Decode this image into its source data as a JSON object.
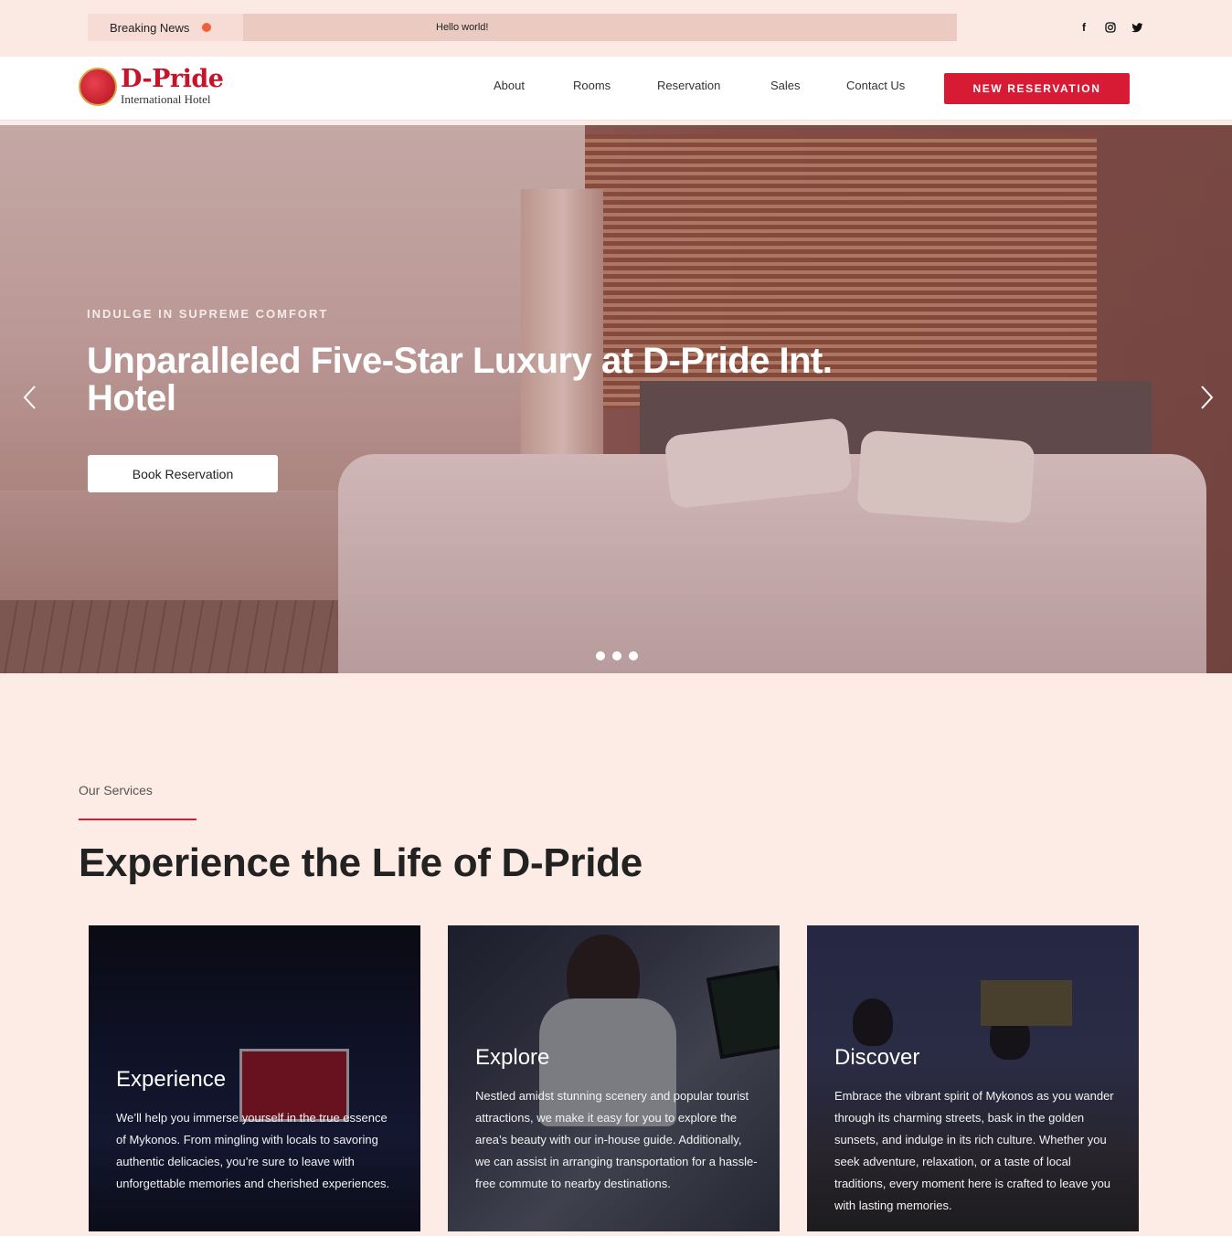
{
  "topbar": {
    "breaking_label": "Breaking News",
    "ticker_text": "Hello world!",
    "social": [
      {
        "name": "facebook-icon",
        "glyph": "f"
      },
      {
        "name": "instagram-icon",
        "glyph": "◎"
      },
      {
        "name": "twitter-icon",
        "glyph": "🐦"
      }
    ]
  },
  "header": {
    "logo_title": "D-Pride",
    "logo_subtitle": "International Hotel",
    "nav": [
      "About",
      "Rooms",
      "Reservation",
      "Sales",
      "Contact Us"
    ],
    "cta_label": "NEW RESERVATION"
  },
  "hero": {
    "kicker": "INDULGE IN SUPREME COMFORT",
    "title": "Unparalleled Five-Star Luxury at D-Pride Int. Hotel",
    "button_label": "Book Reservation",
    "prev_arrow": "‹",
    "next_arrow": "›",
    "slide_count": 3
  },
  "services": {
    "label": "Our Services",
    "title": "Experience the Life of D-Pride",
    "cards": [
      {
        "title": "Experience",
        "text": "We’ll help you immerse yourself in the true essence of Mykonos. From mingling with locals to savoring authentic delicacies, you’re sure to leave with unforgettable memories and cherished experiences."
      },
      {
        "title": "Explore",
        "text": "Nestled amidst stunning scenery and popular tourist attractions, we make it easy for you to explore the area’s beauty with our in-house guide. Additionally, we can assist in arranging transportation for a hassle-free commute to nearby destinations."
      },
      {
        "title": "Discover",
        "text": "Embrace the vibrant spirit of Mykonos as you wander through its charming streets, bask in the golden sunsets, and indulge in its rich culture. Whether you seek adventure, relaxation, or a taste of local traditions, every moment here is crafted to leave you with lasting memories."
      }
    ]
  },
  "colors": {
    "accent": "#d81b35",
    "page_bg": "#fdece6",
    "breaking_dot": "#f2603a"
  }
}
